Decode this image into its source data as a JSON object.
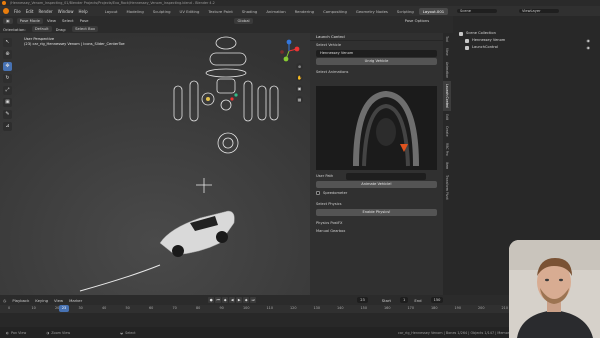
{
  "window": {
    "title": "/Hennessey_Venom_Inspecting_01/Blender Projects/Projects/Eva_Rock/Hennessey_Venom_Inspecting.blend - Blender 4.2"
  },
  "menu": {
    "items": [
      "File",
      "Edit",
      "Render",
      "Window",
      "Help"
    ],
    "workspaces": [
      "Layout",
      "Modeling",
      "Sculpting",
      "UV Editing",
      "Texture Paint",
      "Shading",
      "Animation",
      "Rendering",
      "Compositing",
      "Geometry Nodes",
      "Scripting",
      "Layout.001"
    ],
    "active_workspace": "Layout.001",
    "scene": "Scene",
    "view_layer": "ViewLayer"
  },
  "viewport_header": {
    "mode": "Pose Mode",
    "menus": [
      "View",
      "Select",
      "Pose"
    ],
    "transform": "Global",
    "options": "Pose Options"
  },
  "subheader": {
    "orientation": "Orientation:",
    "default": "Default",
    "drag": "Drag:",
    "select": "Select Box"
  },
  "viewport_info": {
    "line1": "User Perspective",
    "line2": "(23) car_rig_Hennessey Venom | Icons_Slider_CenterToe"
  },
  "npanel": {
    "title": "Launch Control",
    "select_vehicle_label": "Select Vehicle",
    "vehicle": "Hennessey Venom",
    "unrig_button": "Unrig Vehicle",
    "select_animations_label": "Select Animations",
    "user_path_label": "User Path",
    "animate_button": "Animate Vehicle!",
    "speedometer_label": "Speedometer",
    "select_physics_label": "Select Physics",
    "enable_physics_button": "Enable Physics!",
    "physics_postfx_label": "Physics PostFX",
    "manual_gearbox_label": "Manual Gearbox",
    "tabs": [
      "Tool",
      "View",
      "Animation",
      "Launch Control",
      "Edit",
      "Create",
      "RBC Pro",
      "Item",
      "Transform Pivot"
    ]
  },
  "outliner": {
    "title": "Scene Collection",
    "items": [
      "Scene Collection",
      "Hennessey Venom",
      "LaunchControl"
    ]
  },
  "timeline": {
    "menus": [
      "Playback",
      "Keying",
      "View",
      "Marker"
    ],
    "current_frame": "23",
    "start_label": "Start",
    "start": "1",
    "end_label": "End",
    "end": "150",
    "ticks": [
      "0",
      "10",
      "20",
      "30",
      "40",
      "50",
      "60",
      "70",
      "80",
      "90",
      "100",
      "110",
      "120",
      "130",
      "140",
      "150",
      "160",
      "170",
      "180",
      "190",
      "200",
      "210",
      "220",
      "230",
      "240",
      "250"
    ]
  },
  "statusbar": {
    "left": [
      "Pan View",
      "Zoom View",
      "Select"
    ],
    "right": "car_rig_Hennessey Venom | Bones 1/264 | Objects 1/147 | Memory 300.5 MiB | VRAM 4.1/24.0 GiB | 4.2.1"
  }
}
